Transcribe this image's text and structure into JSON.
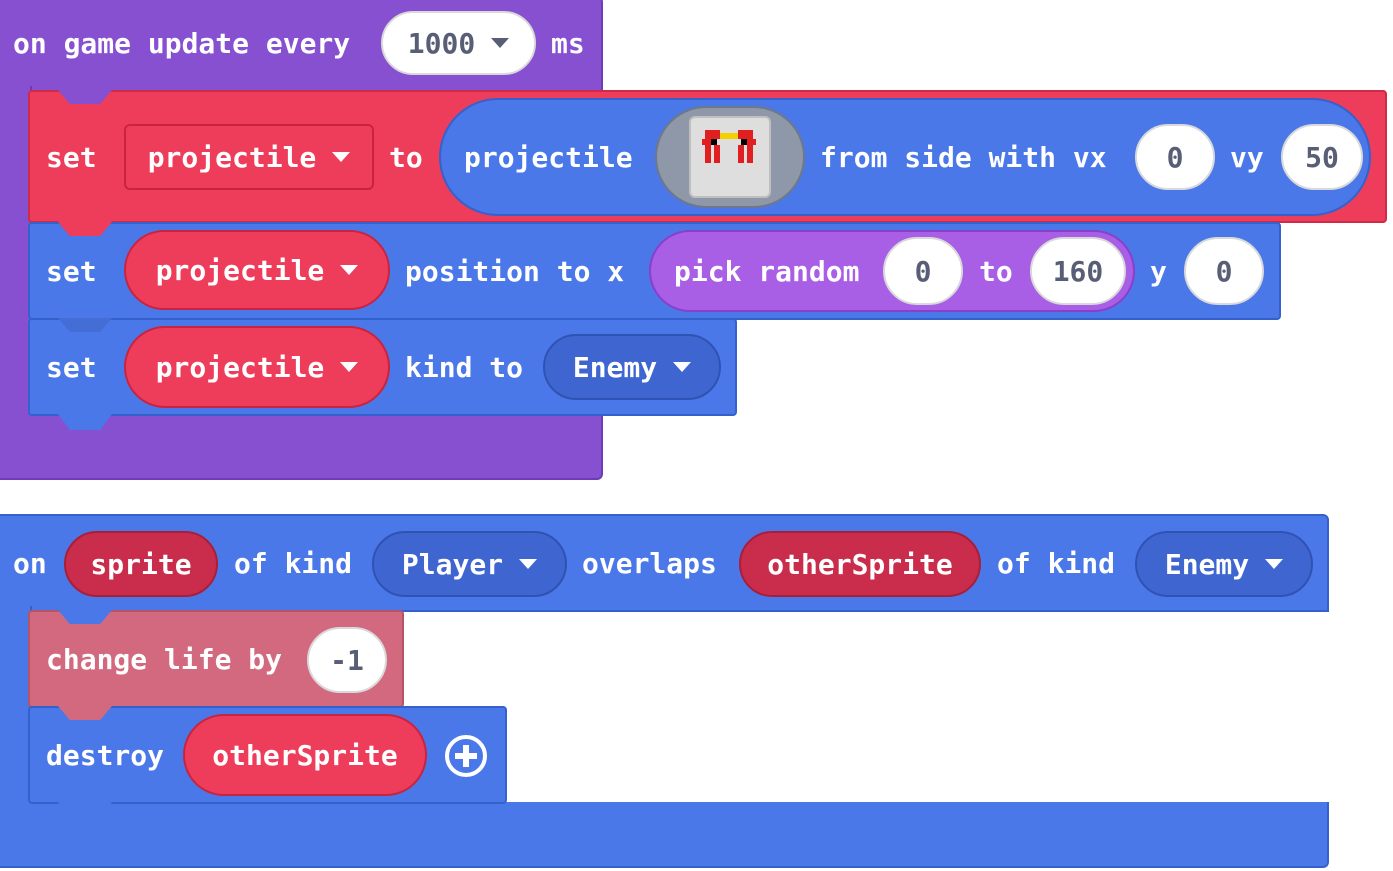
{
  "block1": {
    "event_prefix": "on game update every",
    "interval_value": "1000",
    "interval_unit": "ms",
    "stmt1": {
      "set": "set",
      "var": "projectile",
      "to": "to",
      "reporter": "projectile",
      "from_side": "from side with vx",
      "vx": "0",
      "vy_label": "vy",
      "vy": "50"
    },
    "stmt2": {
      "set": "set",
      "var": "projectile",
      "position_to_x": "position to x",
      "pick_random": "pick random",
      "min": "0",
      "to": "to",
      "max": "160",
      "y_label": "y",
      "y": "0"
    },
    "stmt3": {
      "set": "set",
      "var": "projectile",
      "kind_to": "kind to",
      "kind": "Enemy"
    }
  },
  "block2": {
    "on": "on",
    "sprite_var": "sprite",
    "of_kind_1": "of kind",
    "kind1": "Player",
    "overlaps": "overlaps",
    "other_var": "otherSprite",
    "of_kind_2": "of kind",
    "kind2": "Enemy",
    "stmt1": {
      "label": "change life by",
      "value": "-1"
    },
    "stmt2": {
      "label": "destroy",
      "var": "otherSprite"
    }
  },
  "colors": {
    "purple_event": "#8650d0",
    "blue_event": "#4a78e8",
    "sprite_red": "#ee3d5a",
    "info_pink": "#d2697f",
    "math_purple": "#a95ee6"
  },
  "icons": {
    "sprite_image": "red-spaceship-sprite",
    "add_parameter": "plus-circle-icon",
    "dropdown": "caret-down-icon"
  }
}
